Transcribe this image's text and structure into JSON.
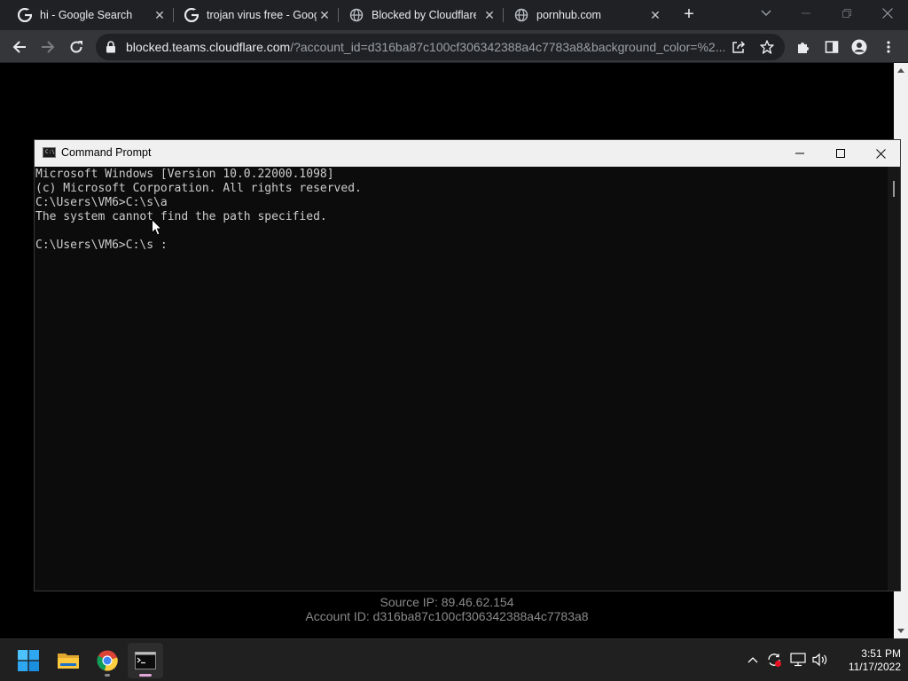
{
  "browser": {
    "tabs": [
      {
        "title": "hi - Google Search",
        "favicon": "google-g-icon",
        "active": false
      },
      {
        "title": "trojan virus free - Google Search",
        "favicon": "google-g-icon",
        "active": false
      },
      {
        "title": "Blocked by Cloudflare Gateway",
        "favicon": "globe-icon",
        "active": true
      },
      {
        "title": "pornhub.com",
        "favicon": "globe-icon",
        "active": false
      }
    ],
    "address_bar": {
      "host": "blocked.teams.cloudflare.com",
      "path": "/?account_id=d316ba87c100cf306342388a4c7783a8&background_color=%2..."
    }
  },
  "page": {
    "source_ip": "Source IP: 89.46.62.154",
    "account_id": "Account ID: d316ba87c100cf306342388a4c7783a8"
  },
  "cmd": {
    "title": "Command Prompt",
    "lines": [
      "Microsoft Windows [Version 10.0.22000.1098]",
      "(c) Microsoft Corporation. All rights reserved.",
      "C:\\Users\\VM6>C:\\s\\a",
      "The system cannot find the path specified.",
      "",
      "C:\\Users\\VM6>C:\\s :"
    ]
  },
  "taskbar": {
    "apps": [
      "windows-start-icon",
      "file-explorer-icon",
      "chrome-icon",
      "command-prompt-icon"
    ],
    "clock": {
      "time": "3:51 PM",
      "date": "11/17/2022"
    }
  },
  "colors": {
    "chrome_frame": "#202124",
    "chrome_toolbar": "#35363a",
    "console_bg": "#0c0c0c",
    "console_text": "#cccccc",
    "page_footer_text": "#8a8a8a",
    "taskbar": "#202020"
  }
}
